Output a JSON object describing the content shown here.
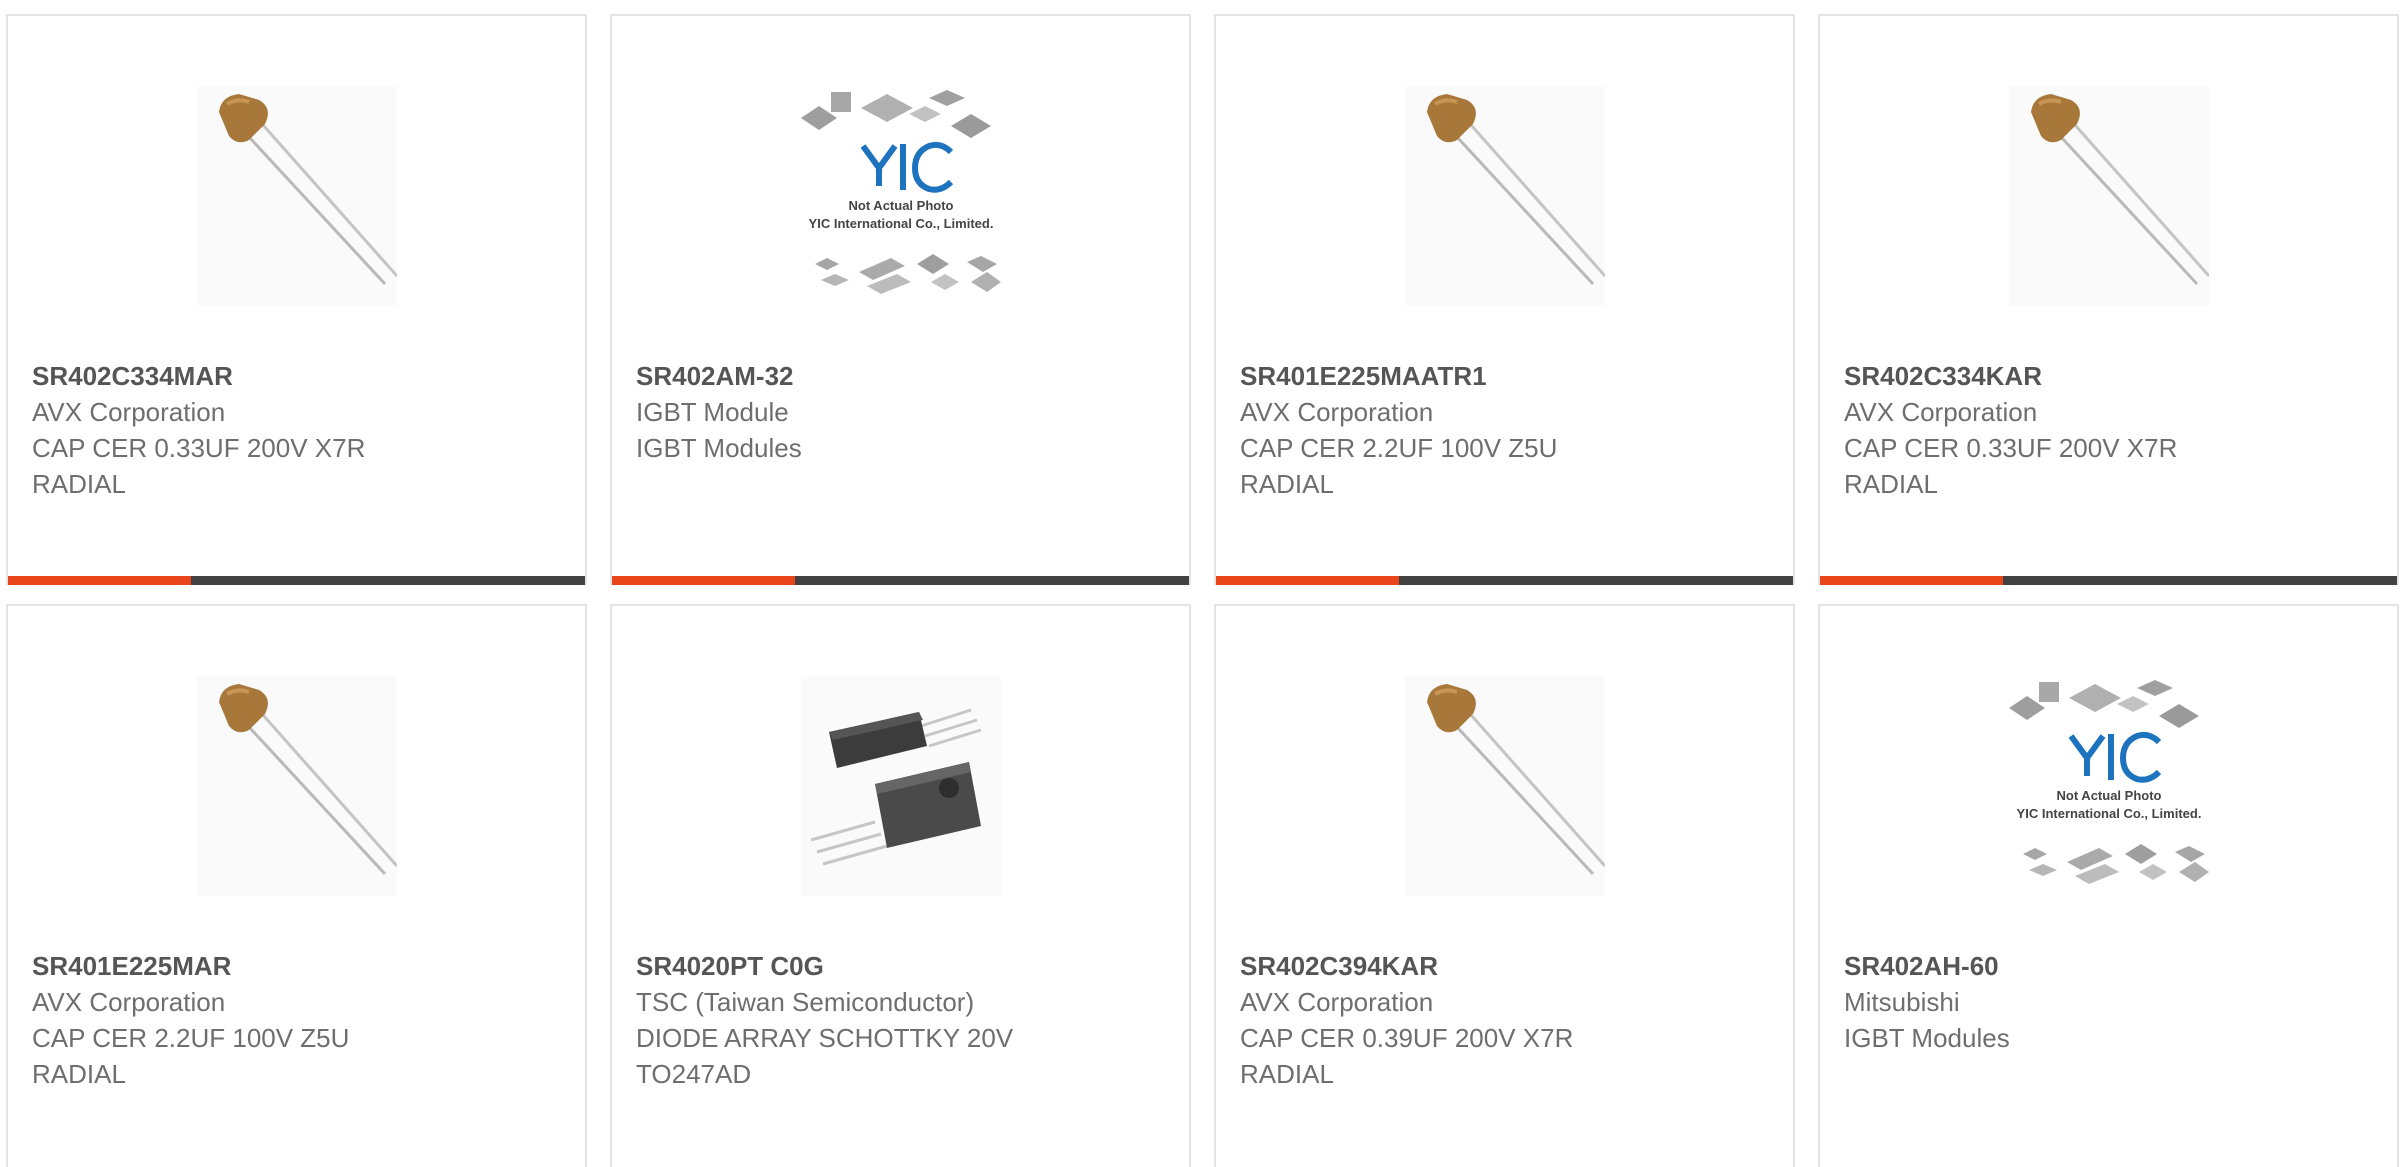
{
  "products": [
    {
      "part_number": "SR402C334MAR",
      "manufacturer": "AVX Corporation",
      "description": "CAP CER 0.33UF 200V X7R RADIAL",
      "image": "ceramic-capacitor"
    },
    {
      "part_number": "SR402AM-32",
      "manufacturer": "IGBT Module",
      "description": "IGBT Modules",
      "image": "placeholder",
      "placeholder_line1": "Not Actual Photo",
      "placeholder_line2": "YIC International Co., Limited."
    },
    {
      "part_number": "SR401E225MAATR1",
      "manufacturer": "AVX Corporation",
      "description": "CAP CER 2.2UF 100V Z5U RADIAL",
      "image": "ceramic-capacitor"
    },
    {
      "part_number": "SR402C334KAR",
      "manufacturer": "AVX Corporation",
      "description": "CAP CER 0.33UF 200V X7R RADIAL",
      "image": "ceramic-capacitor"
    },
    {
      "part_number": "SR401E225MAR",
      "manufacturer": "AVX Corporation",
      "description": "CAP CER 2.2UF 100V Z5U RADIAL",
      "image": "ceramic-capacitor"
    },
    {
      "part_number": "SR4020PT C0G",
      "manufacturer": "TSC (Taiwan Semiconductor)",
      "description": "DIODE ARRAY SCHOTTKY 20V TO247AD",
      "image": "to247-package"
    },
    {
      "part_number": "SR402C394KAR",
      "manufacturer": "AVX Corporation",
      "description": "CAP CER 0.39UF 200V X7R RADIAL",
      "image": "ceramic-capacitor"
    },
    {
      "part_number": "SR402AH-60",
      "manufacturer": "Mitsubishi",
      "description": "IGBT Modules",
      "image": "placeholder",
      "placeholder_line1": "Not Actual Photo",
      "placeholder_line2": "YIC International Co., Limited."
    }
  ],
  "placeholder_logo": "YIC",
  "colors": {
    "accent": "#e8461a",
    "bar": "#424242",
    "border": "#e4e4e4",
    "part_number": "#555555",
    "text": "#6e6e6e",
    "capacitor_body": "#a8773a",
    "logo_blue": "#1e73be"
  }
}
